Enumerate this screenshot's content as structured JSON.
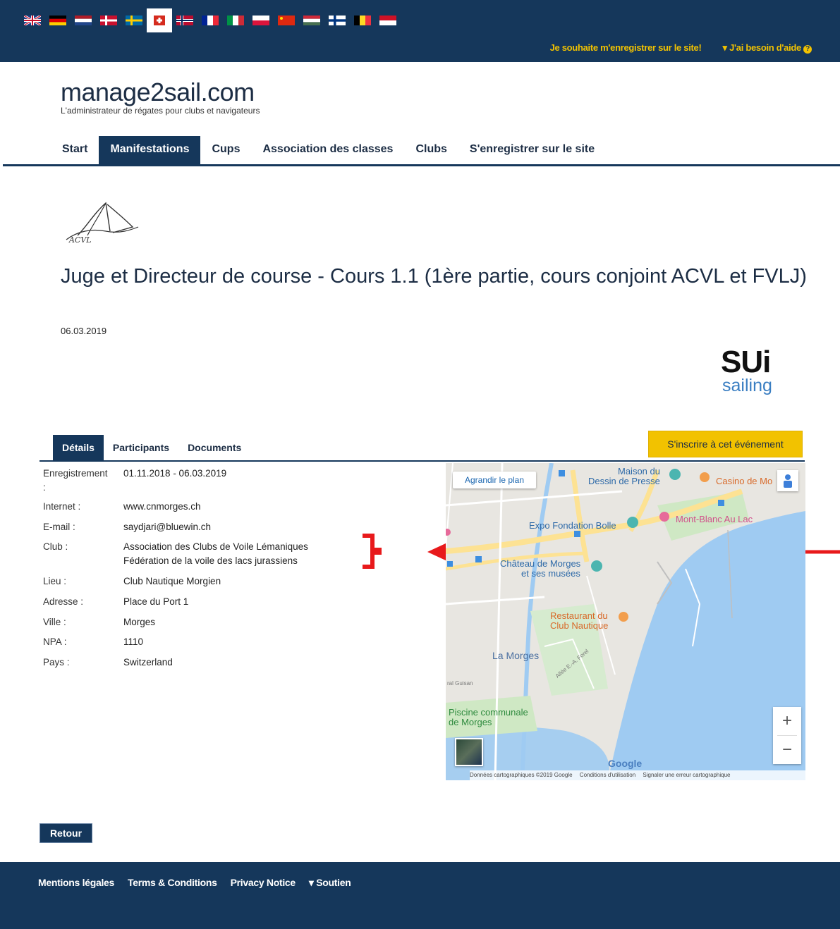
{
  "top": {
    "flags": [
      "uk",
      "de",
      "nl",
      "dk",
      "se",
      "ch",
      "no",
      "fr",
      "it",
      "pl",
      "cn",
      "hu",
      "fi",
      "be",
      "id"
    ],
    "active_flag": "ch",
    "register_link": "Je souhaite m'enregistrer sur le site!",
    "help_link": "J'ai besoin d'aide",
    "help_icon": "question-icon"
  },
  "brand": {
    "title": "manage2sail.com",
    "subtitle": "L'administrateur de régates pour clubs et navigateurs"
  },
  "nav": {
    "items": [
      "Start",
      "Manifestations",
      "Cups",
      "Association des classes",
      "Clubs",
      "S'enregistrer sur le site"
    ],
    "active": "Manifestations"
  },
  "event": {
    "logo_text": "ACVL",
    "title": "Juge et Directeur de course - Cours 1.1 (1ère partie, cours conjoint ACVL et FVLJ)",
    "date": "06.03.2019"
  },
  "sui_logo": {
    "main": "SUi",
    "sub": "sailing"
  },
  "tabs": {
    "items": [
      "Détails",
      "Participants",
      "Documents"
    ],
    "active": "Détails"
  },
  "register_button": "S'inscrire à cet événement",
  "details": {
    "enregistrement_label": "Enregistrement",
    "enregistrement_colon": ":",
    "enregistrement_value": "01.11.2018 - 06.03.2019",
    "internet_label": "Internet :",
    "internet_value": "www.cnmorges.ch",
    "email_label": "E-mail :",
    "email_value": "saydjari@bluewin.ch",
    "club_label": "Club :",
    "club_value_1": "Association des Clubs de Voile Lémaniques",
    "club_value_2": "Fédération de la voile des lacs jurassiens",
    "lieu_label": "Lieu :",
    "lieu_value": "Club Nautique Morgien",
    "adresse_label": "Adresse :",
    "adresse_value": "Place du Port 1",
    "ville_label": "Ville :",
    "ville_value": "Morges",
    "npa_label": "NPA :",
    "npa_value": "1110",
    "pays_label": "Pays :",
    "pays_value": "Switzerland"
  },
  "map": {
    "enlarge": "Agrandir le plan",
    "labels": {
      "maison_1": "Maison du",
      "maison_2": "Dessin de Presse",
      "casino": "Casino de Mo",
      "expo": "Expo Fondation Bolle",
      "mont_blanc": "Mont-Blanc Au Lac",
      "chateau_1": "Château de Morges",
      "chateau_2": "et ses musées",
      "restaurant_1": "Restaurant du",
      "restaurant_2": "Club Nautique",
      "la_morges": "La Morges",
      "piscine_1": "Piscine communale",
      "piscine_2": "de Morges",
      "allee": "Allée E.-A. Forel",
      "gulisan": "ral Guisan"
    },
    "zoom_in": "+",
    "zoom_out": "−",
    "google": "Google",
    "footer_data": "Données cartographiques ©2019 Google",
    "footer_terms": "Conditions d'utilisation",
    "footer_report": "Signaler une erreur cartographique"
  },
  "retour_button": "Retour",
  "footer": {
    "links": [
      "Mentions légales",
      "Terms & Conditions",
      "Privacy Notice",
      "Soutien"
    ]
  },
  "colors": {
    "navy": "#15375b",
    "yellow": "#f2c200",
    "annotation_red": "#e8191b"
  }
}
